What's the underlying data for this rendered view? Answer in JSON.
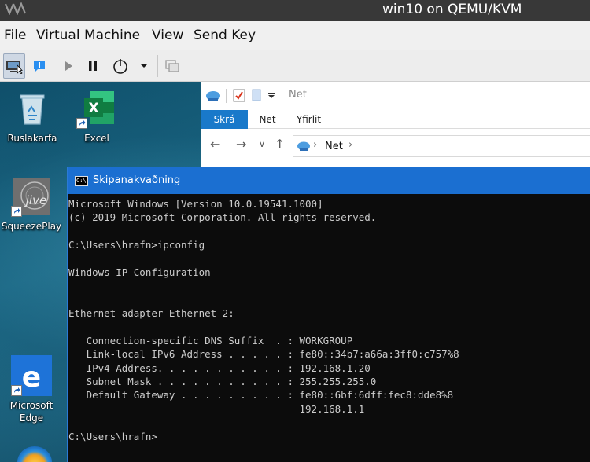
{
  "host": {
    "title": "win10 on QEMU/KVM",
    "menu": [
      "File",
      "Virtual Machine",
      "View",
      "Send Key"
    ],
    "toolbar": [
      {
        "name": "console-icon"
      },
      {
        "name": "details-icon"
      },
      {
        "name": "play-icon"
      },
      {
        "name": "pause-icon"
      },
      {
        "name": "power-icon"
      },
      {
        "name": "chevron-down-icon"
      },
      {
        "name": "screenshot-icon"
      }
    ]
  },
  "desktop": {
    "icons": [
      {
        "label": "Ruslakarfa",
        "icon": "recycle-bin-icon"
      },
      {
        "label": "Excel",
        "icon": "excel-icon"
      },
      {
        "label": "SqueezePlay",
        "icon": "squeezeplay-icon"
      },
      {
        "label": "Microsoft Edge",
        "icon": "edge-icon"
      }
    ]
  },
  "explorer": {
    "title": "Net",
    "tabs": [
      "Skrá",
      "Net",
      "Yfirlit"
    ],
    "address": "Net"
  },
  "cmd": {
    "title": "Skipanakvaðning",
    "lines": [
      "Microsoft Windows [Version 10.0.19541.1000]",
      "(c) 2019 Microsoft Corporation. All rights reserved.",
      "",
      "C:\\Users\\hrafn>ipconfig",
      "",
      "Windows IP Configuration",
      "",
      "",
      "Ethernet adapter Ethernet 2:",
      "",
      "   Connection-specific DNS Suffix  . : WORKGROUP",
      "   Link-local IPv6 Address . . . . . : fe80::34b7:a66a:3ff0:c757%8",
      "   IPv4 Address. . . . . . . . . . . : 192.168.1.20",
      "   Subnet Mask . . . . . . . . . . . : 255.255.255.0",
      "   Default Gateway . . . . . . . . . : fe80::6bf:6dff:fec8:dde8%8",
      "                                       192.168.1.1",
      "",
      "C:\\Users\\hrafn>"
    ]
  },
  "colors": {
    "cmd_titlebar": "#1b6fd1",
    "cmd_background": "#0c0c0c",
    "cmd_text": "#cccccc",
    "ribbon_file_tab": "#1979ca"
  }
}
